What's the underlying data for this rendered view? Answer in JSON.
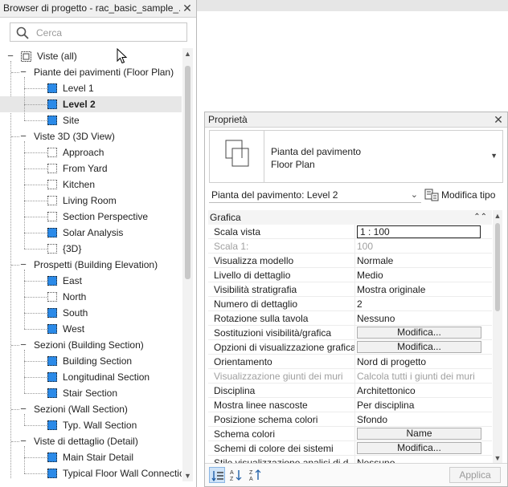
{
  "browser": {
    "title": "Browser di progetto - rac_basic_sample_...",
    "search_placeholder": "Cerca",
    "tree": [
      {
        "label": "Viste (all)",
        "level": 0,
        "type": "root",
        "toggle": "−"
      },
      {
        "label": "Piante dei pavimenti (Floor Plan)",
        "level": 1,
        "type": "group",
        "toggle": "−"
      },
      {
        "label": "Level 1",
        "level": 2,
        "type": "view",
        "icon": "blue"
      },
      {
        "label": "Level 2",
        "level": 2,
        "type": "view",
        "icon": "blue",
        "selected": true
      },
      {
        "label": "Site",
        "level": 2,
        "type": "view",
        "icon": "blue"
      },
      {
        "label": "Viste 3D (3D View)",
        "level": 1,
        "type": "group",
        "toggle": "−"
      },
      {
        "label": "Approach",
        "level": 2,
        "type": "view",
        "icon": "white"
      },
      {
        "label": "From Yard",
        "level": 2,
        "type": "view",
        "icon": "white"
      },
      {
        "label": "Kitchen",
        "level": 2,
        "type": "view",
        "icon": "white"
      },
      {
        "label": "Living Room",
        "level": 2,
        "type": "view",
        "icon": "white"
      },
      {
        "label": "Section Perspective",
        "level": 2,
        "type": "view",
        "icon": "white"
      },
      {
        "label": "Solar Analysis",
        "level": 2,
        "type": "view",
        "icon": "blue"
      },
      {
        "label": "{3D}",
        "level": 2,
        "type": "view",
        "icon": "white"
      },
      {
        "label": "Prospetti (Building Elevation)",
        "level": 1,
        "type": "group",
        "toggle": "−"
      },
      {
        "label": "East",
        "level": 2,
        "type": "view",
        "icon": "blue"
      },
      {
        "label": "North",
        "level": 2,
        "type": "view",
        "icon": "white"
      },
      {
        "label": "South",
        "level": 2,
        "type": "view",
        "icon": "blue"
      },
      {
        "label": "West",
        "level": 2,
        "type": "view",
        "icon": "blue"
      },
      {
        "label": "Sezioni (Building Section)",
        "level": 1,
        "type": "group",
        "toggle": "−"
      },
      {
        "label": "Building Section",
        "level": 2,
        "type": "view",
        "icon": "blue"
      },
      {
        "label": "Longitudinal Section",
        "level": 2,
        "type": "view",
        "icon": "blue"
      },
      {
        "label": "Stair Section",
        "level": 2,
        "type": "view",
        "icon": "blue"
      },
      {
        "label": "Sezioni (Wall Section)",
        "level": 1,
        "type": "group",
        "toggle": "−"
      },
      {
        "label": "Typ. Wall Section",
        "level": 2,
        "type": "view",
        "icon": "blue"
      },
      {
        "label": "Viste di dettaglio (Detail)",
        "level": 1,
        "type": "group",
        "toggle": "−"
      },
      {
        "label": "Main Stair Detail",
        "level": 2,
        "type": "view",
        "icon": "blue"
      },
      {
        "label": "Typical Floor Wall Connectic",
        "level": 2,
        "type": "view",
        "icon": "blue"
      }
    ]
  },
  "properties": {
    "title": "Proprietà",
    "type_line1": "Pianta del pavimento",
    "type_line2": "Floor Plan",
    "instance_selector": "Pianta del pavimento: Level 2",
    "edit_type": "Modifica tipo",
    "group": "Grafica",
    "rows": [
      {
        "name": "Scala vista",
        "value": "1 : 100",
        "kind": "input"
      },
      {
        "name": "Scala  1:",
        "value": "100",
        "kind": "text",
        "disabled": true
      },
      {
        "name": "Visualizza modello",
        "value": "Normale",
        "kind": "text"
      },
      {
        "name": "Livello di dettaglio",
        "value": "Medio",
        "kind": "text"
      },
      {
        "name": "Visibilità stratigrafia",
        "value": "Mostra originale",
        "kind": "text"
      },
      {
        "name": "Numero di dettaglio",
        "value": "2",
        "kind": "text"
      },
      {
        "name": "Rotazione sulla tavola",
        "value": "Nessuno",
        "kind": "text"
      },
      {
        "name": "Sostituzioni visibilità/grafica",
        "value": "Modifica...",
        "kind": "button"
      },
      {
        "name": "Opzioni di visualizzazione grafica",
        "value": "Modifica...",
        "kind": "button"
      },
      {
        "name": "Orientamento",
        "value": "Nord di progetto",
        "kind": "text"
      },
      {
        "name": "Visualizzazione giunti dei muri",
        "value": "Calcola tutti i giunti dei muri",
        "kind": "text",
        "disabled": true
      },
      {
        "name": "Disciplina",
        "value": "Architettonico",
        "kind": "text"
      },
      {
        "name": "Mostra linee nascoste",
        "value": "Per disciplina",
        "kind": "text"
      },
      {
        "name": "Posizione schema colori",
        "value": "Sfondo",
        "kind": "text"
      },
      {
        "name": "Schema colori",
        "value": "Name",
        "kind": "button"
      },
      {
        "name": "Schemi di colore dei sistemi",
        "value": "Modifica...",
        "kind": "button"
      },
      {
        "name": "Stile visualizzazione analisi di d...",
        "value": "Nessuno",
        "kind": "text"
      }
    ],
    "apply_label": "Applica"
  }
}
